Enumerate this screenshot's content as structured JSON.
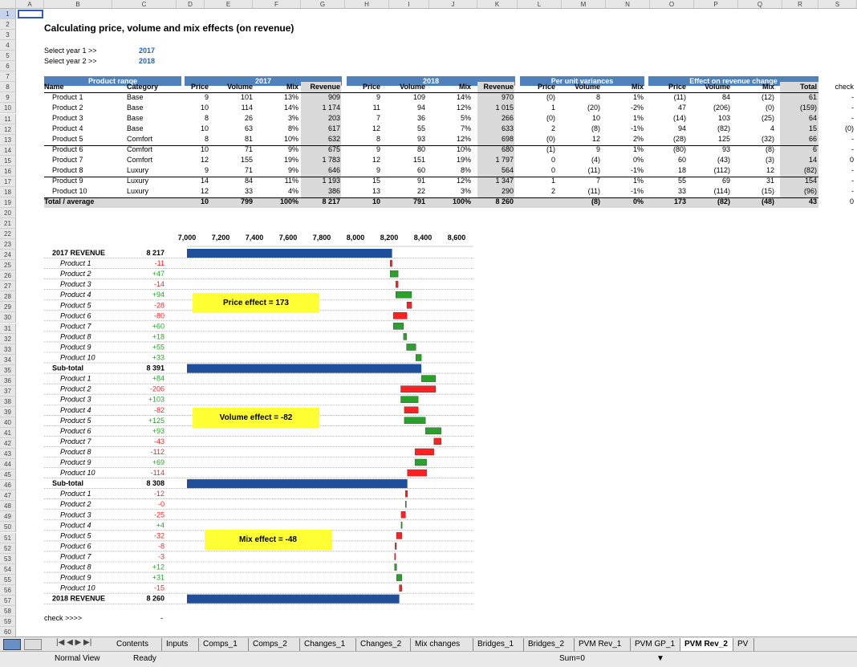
{
  "columns": [
    "A",
    "B",
    "C",
    "D",
    "E",
    "F",
    "G",
    "H",
    "I",
    "J",
    "K",
    "L",
    "M",
    "N",
    "O",
    "P",
    "Q",
    "R",
    "S"
  ],
  "title": "Calculating price, volume and mix effects (on revenue)",
  "select_year1_label": "Select year 1 >>",
  "select_year2_label": "Select year 2 >>",
  "year1": "2017",
  "year2": "2018",
  "bands": {
    "product_range": "Product range",
    "y2017": "2017",
    "y2018": "2018",
    "unit_var": "Per unit variances",
    "effect": "Effect on revenue change"
  },
  "headers": [
    "Name",
    "Category",
    "Price",
    "Volume",
    "Mix",
    "Revenue",
    "Price",
    "Volume",
    "Mix",
    "Revenue",
    "Price",
    "Volume",
    "Mix",
    "Price",
    "Volume",
    "Mix",
    "Total",
    "check"
  ],
  "rows": [
    [
      "Product 1",
      "Base",
      "9",
      "101",
      "13%",
      "909",
      "9",
      "109",
      "14%",
      "970",
      "(0)",
      "8",
      "1%",
      "(11)",
      "84",
      "(12)",
      "61",
      "-"
    ],
    [
      "Product 2",
      "Base",
      "10",
      "114",
      "14%",
      "1 174",
      "11",
      "94",
      "12%",
      "1 015",
      "1",
      "(20)",
      "-2%",
      "47",
      "(206)",
      "(0)",
      "(159)",
      "-"
    ],
    [
      "Product 3",
      "Base",
      "8",
      "26",
      "3%",
      "203",
      "7",
      "36",
      "5%",
      "266",
      "(0)",
      "10",
      "1%",
      "(14)",
      "103",
      "(25)",
      "64",
      "-"
    ],
    [
      "Product 4",
      "Base",
      "10",
      "63",
      "8%",
      "617",
      "12",
      "55",
      "7%",
      "633",
      "2",
      "(8)",
      "-1%",
      "94",
      "(82)",
      "4",
      "15",
      "(0)"
    ],
    [
      "Product 5",
      "Comfort",
      "8",
      "81",
      "10%",
      "632",
      "8",
      "93",
      "12%",
      "698",
      "(0)",
      "12",
      "2%",
      "(28)",
      "125",
      "(32)",
      "66",
      "-"
    ],
    [
      "Product 6",
      "Comfort",
      "10",
      "71",
      "9%",
      "675",
      "9",
      "80",
      "10%",
      "680",
      "(1)",
      "9",
      "1%",
      "(80)",
      "93",
      "(8)",
      "6",
      "-"
    ],
    [
      "Product 7",
      "Comfort",
      "12",
      "155",
      "19%",
      "1 783",
      "12",
      "151",
      "19%",
      "1 797",
      "0",
      "(4)",
      "0%",
      "60",
      "(43)",
      "(3)",
      "14",
      "0"
    ],
    [
      "Product 8",
      "Luxury",
      "9",
      "71",
      "9%",
      "646",
      "9",
      "60",
      "8%",
      "564",
      "0",
      "(11)",
      "-1%",
      "18",
      "(112)",
      "12",
      "(82)",
      "-"
    ],
    [
      "Product 9",
      "Luxury",
      "14",
      "84",
      "11%",
      "1 193",
      "15",
      "91",
      "12%",
      "1 347",
      "1",
      "7",
      "1%",
      "55",
      "69",
      "31",
      "154",
      "-"
    ],
    [
      "Product 10",
      "Luxury",
      "12",
      "33",
      "4%",
      "386",
      "13",
      "22",
      "3%",
      "290",
      "2",
      "(11)",
      "-1%",
      "33",
      "(114)",
      "(15)",
      "(96)",
      "-"
    ]
  ],
  "total_row": [
    "Total / average",
    "",
    "10",
    "799",
    "100%",
    "8 217",
    "10",
    "791",
    "100%",
    "8 260",
    "",
    "(8)",
    "0%",
    "173",
    "(82)",
    "(48)",
    "43",
    "0"
  ],
  "chart_data": {
    "type": "bar",
    "x_ticks": [
      "7,000",
      "7,200",
      "7,400",
      "7,600",
      "7,800",
      "8,000",
      "8,200",
      "8,400",
      "8,600"
    ],
    "xlim": [
      7000,
      8700
    ],
    "items": [
      {
        "label": "2017 REVENUE",
        "value": "8 217",
        "kind": "total",
        "base": 8217
      },
      {
        "label": "Product 1",
        "value": "-11",
        "kind": "delta",
        "delta": -11
      },
      {
        "label": "Product 2",
        "value": "+47",
        "kind": "delta",
        "delta": 47
      },
      {
        "label": "Product 3",
        "value": "-14",
        "kind": "delta",
        "delta": -14
      },
      {
        "label": "Product 4",
        "value": "+94",
        "kind": "delta",
        "delta": 94
      },
      {
        "label": "Product 5",
        "value": "-28",
        "kind": "delta",
        "delta": -28
      },
      {
        "label": "Product 6",
        "value": "-80",
        "kind": "delta",
        "delta": -80
      },
      {
        "label": "Product 7",
        "value": "+60",
        "kind": "delta",
        "delta": 60
      },
      {
        "label": "Product 8",
        "value": "+18",
        "kind": "delta",
        "delta": 18
      },
      {
        "label": "Product 9",
        "value": "+55",
        "kind": "delta",
        "delta": 55
      },
      {
        "label": "Product 10",
        "value": "+33",
        "kind": "delta",
        "delta": 33
      },
      {
        "label": "Sub-total",
        "value": "8 391",
        "kind": "total",
        "base": 8391
      },
      {
        "label": "Product 1",
        "value": "+84",
        "kind": "delta",
        "delta": 84
      },
      {
        "label": "Product 2",
        "value": "-206",
        "kind": "delta",
        "delta": -206
      },
      {
        "label": "Product 3",
        "value": "+103",
        "kind": "delta",
        "delta": 103
      },
      {
        "label": "Product 4",
        "value": "-82",
        "kind": "delta",
        "delta": -82
      },
      {
        "label": "Product 5",
        "value": "+125",
        "kind": "delta",
        "delta": 125
      },
      {
        "label": "Product 6",
        "value": "+93",
        "kind": "delta",
        "delta": 93
      },
      {
        "label": "Product 7",
        "value": "-43",
        "kind": "delta",
        "delta": -43
      },
      {
        "label": "Product 8",
        "value": "-112",
        "kind": "delta",
        "delta": -112
      },
      {
        "label": "Product 9",
        "value": "+69",
        "kind": "delta",
        "delta": 69
      },
      {
        "label": "Product 10",
        "value": "-114",
        "kind": "delta",
        "delta": -114
      },
      {
        "label": "Sub-total",
        "value": "8 308",
        "kind": "total",
        "base": 8308
      },
      {
        "label": "Product 1",
        "value": "-12",
        "kind": "delta",
        "delta": -12
      },
      {
        "label": "Product 2",
        "value": "-0",
        "kind": "delta",
        "delta": 0
      },
      {
        "label": "Product 3",
        "value": "-25",
        "kind": "delta",
        "delta": -25
      },
      {
        "label": "Product 4",
        "value": "+4",
        "kind": "delta",
        "delta": 4
      },
      {
        "label": "Product 5",
        "value": "-32",
        "kind": "delta",
        "delta": -32
      },
      {
        "label": "Product 6",
        "value": "-8",
        "kind": "delta",
        "delta": -8
      },
      {
        "label": "Product 7",
        "value": "-3",
        "kind": "delta",
        "delta": -3
      },
      {
        "label": "Product 8",
        "value": "+12",
        "kind": "delta",
        "delta": 12
      },
      {
        "label": "Product 9",
        "value": "+31",
        "kind": "delta",
        "delta": 31
      },
      {
        "label": "Product 10",
        "value": "-15",
        "kind": "delta",
        "delta": -15
      },
      {
        "label": "2018 REVENUE",
        "value": "8 260",
        "kind": "total",
        "base": 8260
      }
    ],
    "colors": {
      "total": "#1f4e9a",
      "up": "#2ca02c",
      "down": "#ff2020"
    }
  },
  "effects": {
    "price": "Price effect = 173",
    "volume": "Volume effect = -82",
    "mix": "Mix effect = -48"
  },
  "check_label": "check >>>>",
  "check_value": "-",
  "tabs": [
    "Contents",
    "Inputs",
    "Comps_1",
    "Comps_2",
    "Changes_1",
    "Changes_2",
    "Mix changes",
    "Bridges_1",
    "Bridges_2",
    "PVM Rev_1",
    "PVM GP_1",
    "PVM Rev_2",
    "PV"
  ],
  "active_tab": "PVM Rev_2",
  "status": {
    "view": "Normal View",
    "state": "Ready",
    "sum": "Sum=0"
  }
}
